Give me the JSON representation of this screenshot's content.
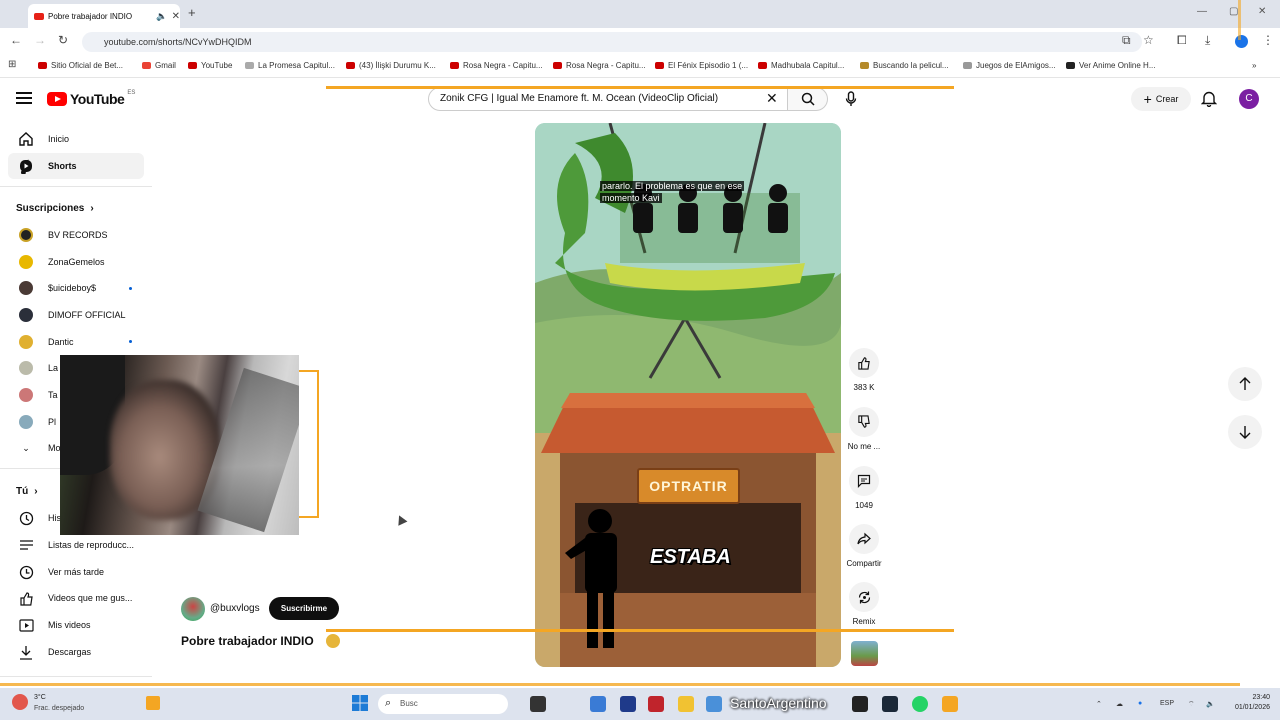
{
  "browser": {
    "tab_title": "Pobre trabajador INDIO",
    "url": "youtube.com/shorts/NCvYwDHQIDM",
    "bookmarks": [
      "Sitio Oficial de Bet...",
      "Gmail",
      "YouTube",
      "La Promesa Capitul...",
      "(43) İlişki Durumu K...",
      "Rosa Negra - Capitu...",
      "Rosa Negra - Capitu...",
      "El Fénix Episodio 1 (...",
      "Madhubala Capitul...",
      "Buscando la pelicul...",
      "Juegos de ElAmigos...",
      "Ver Anime Online H..."
    ]
  },
  "header": {
    "logo": "YouTube",
    "region": "ES",
    "search_value": "Zonik CFG | Igual Me Enamore ft. M. Ocean (VideoClip Oficial)",
    "create_label": "Crear",
    "avatar_letter": "C"
  },
  "sidebar": {
    "inicio": "Inicio",
    "shorts": "Shorts",
    "subs_heading": "Suscripciones",
    "subs": [
      "BV RECORDS",
      "ZonaGemelos",
      "$uicideboy$",
      "DIMOFF OFFICIAL",
      "Dantic",
      "La",
      "Ta",
      "Pl",
      "Mo"
    ],
    "tu_heading": "Tú",
    "historial": "His",
    "listas": "Listas de reproducc...",
    "ver_tarde": "Ver más tarde",
    "gustan": "Videos que me gus...",
    "mis_videos": "Mis videos",
    "descargas": "Descargas"
  },
  "video": {
    "caption": "pararlo. El problema es que en ese momento Kavi",
    "sign": "OPTRATIR",
    "overlay_word": "ESTABA"
  },
  "actions": {
    "likes": "383 K",
    "dislike": "No me ...",
    "comments": "1049",
    "share": "Compartir",
    "remix": "Remix"
  },
  "channel": {
    "handle": "@buxvlogs",
    "subscribe": "Suscribirme",
    "title": "Pobre trabajador INDIO"
  },
  "taskbar": {
    "temp": "3°C",
    "weather": "Frac. despejado",
    "search": "Busc",
    "overlay_name": "SantoArgentino",
    "lang": "ESP",
    "time": "23:40",
    "date": "01/01/2026"
  },
  "colors": {
    "yt_red": "#ff0000",
    "overlay_orange": "#f4a623",
    "link_blue": "#065fd4"
  }
}
